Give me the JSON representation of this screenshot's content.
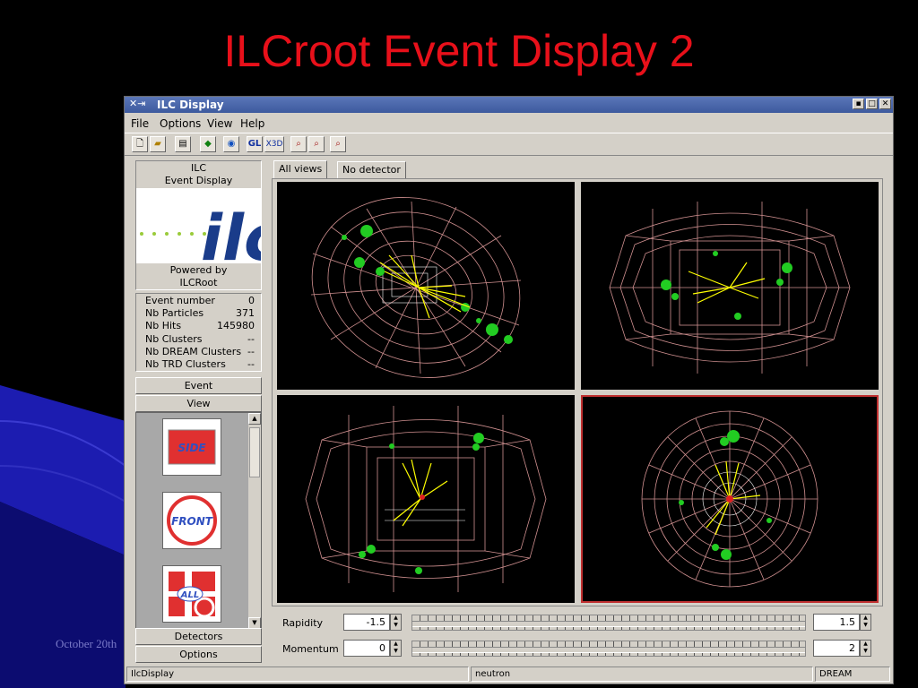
{
  "slide": {
    "title": "ILCroot Event Display 2",
    "footer_text": "October 20th"
  },
  "window": {
    "title": "ILC Display",
    "titlebar_icon": "x-arrow-icon",
    "controls": [
      "minimize",
      "maximize",
      "close"
    ]
  },
  "menu": [
    "File",
    "Options",
    "View",
    "Help"
  ],
  "toolbar": {
    "buttons": [
      "new-icon",
      "open-icon",
      "save-icon",
      "layers-icon",
      "circle-icon",
      "GL",
      "X3D",
      "zoom-icon",
      "zoom-in-icon",
      "zoom-out-icon"
    ],
    "gl_label": "GL",
    "x3d_label": "X3D"
  },
  "left_panel": {
    "logo": {
      "top_text_1": "ILC",
      "top_text_2": "Event Display",
      "logo_text": "ilc",
      "bottom_text_1": "Powered by",
      "bottom_text_2": "ILCRoot"
    },
    "info": [
      {
        "label": "Event number",
        "value": "0"
      },
      {
        "label": "Nb Particles",
        "value": "371"
      },
      {
        "label": "Nb Hits",
        "value": "145980"
      },
      {
        "label": "Nb Clusters",
        "value": "--"
      },
      {
        "label": "Nb DREAM Clusters",
        "value": "--"
      },
      {
        "label": "Nb TRD Clusters",
        "value": "--"
      }
    ],
    "buttons": {
      "event": "Event",
      "view": "View",
      "detectors": "Detectors",
      "options": "Options"
    },
    "view_icons": [
      "SIDE",
      "FRONT",
      "ALL"
    ]
  },
  "tabs": [
    "All views",
    "No detector"
  ],
  "controls": {
    "rapidity_label": "Rapidity",
    "rapidity_min": "-1.5",
    "rapidity_max": "1.5",
    "momentum_label": "Momentum",
    "momentum_min": "0",
    "momentum_max": "2"
  },
  "status_bar": [
    "IlcDisplay",
    "neutron",
    "DREAM"
  ],
  "colors": {
    "title_red": "#e8101a",
    "detector_wire": "#d09090",
    "tracks": "#ffff00",
    "hits": "#22cc22",
    "selected_view_border": "#c03030"
  }
}
